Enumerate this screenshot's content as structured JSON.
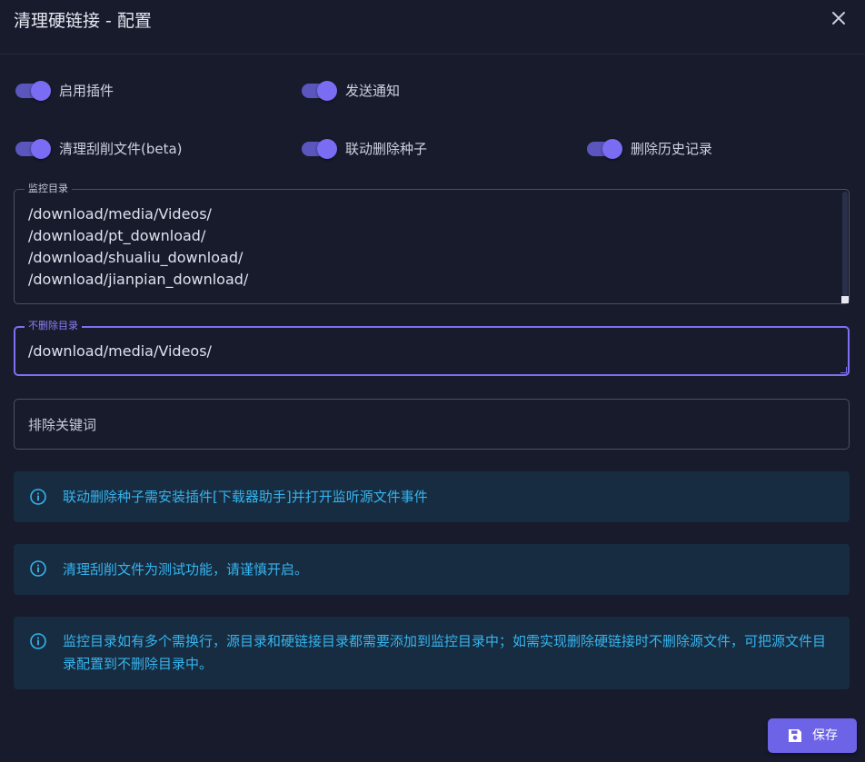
{
  "dialog": {
    "title": "清理硬链接 - 配置",
    "close_icon": "close-icon"
  },
  "switches": [
    {
      "label": "启用插件",
      "checked": true
    },
    {
      "label": "发送通知",
      "checked": true
    },
    {
      "label": "清理刮削文件(beta)",
      "checked": true
    },
    {
      "label": "联动删除种子",
      "checked": true
    },
    {
      "label": "删除历史记录",
      "checked": true
    }
  ],
  "fields": {
    "monitor_dirs": {
      "label": "监控目录",
      "value": "/download/media/Videos/\n/download/pt_download/\n/download/shualiu_download/\n/download/jianpian_download/"
    },
    "exclude_dirs": {
      "label": "不删除目录",
      "value": "/download/media/Videos/"
    },
    "exclude_keywords": {
      "placeholder": "排除关键词",
      "value": ""
    }
  },
  "alerts": [
    {
      "icon": "info-icon",
      "text": "联动删除种子需安装插件[下载器助手]并打开监听源文件事件"
    },
    {
      "icon": "info-icon",
      "text": "清理刮削文件为测试功能，请谨慎开启。"
    },
    {
      "icon": "info-icon",
      "text": "监控目录如有多个需换行，源目录和硬链接目录都需要添加到监控目录中；如需实现删除硬链接时不删除源文件，可把源文件目录配置到不删除目录中。"
    }
  ],
  "actions": {
    "save_label": "保存",
    "save_icon": "floppy-disk-icon"
  },
  "colors": {
    "accent": "#6c63e6",
    "switch_on": "#7b6cf4",
    "info_text": "#35b4ee",
    "info_bg": "#172c41",
    "background": "#171b2c"
  }
}
